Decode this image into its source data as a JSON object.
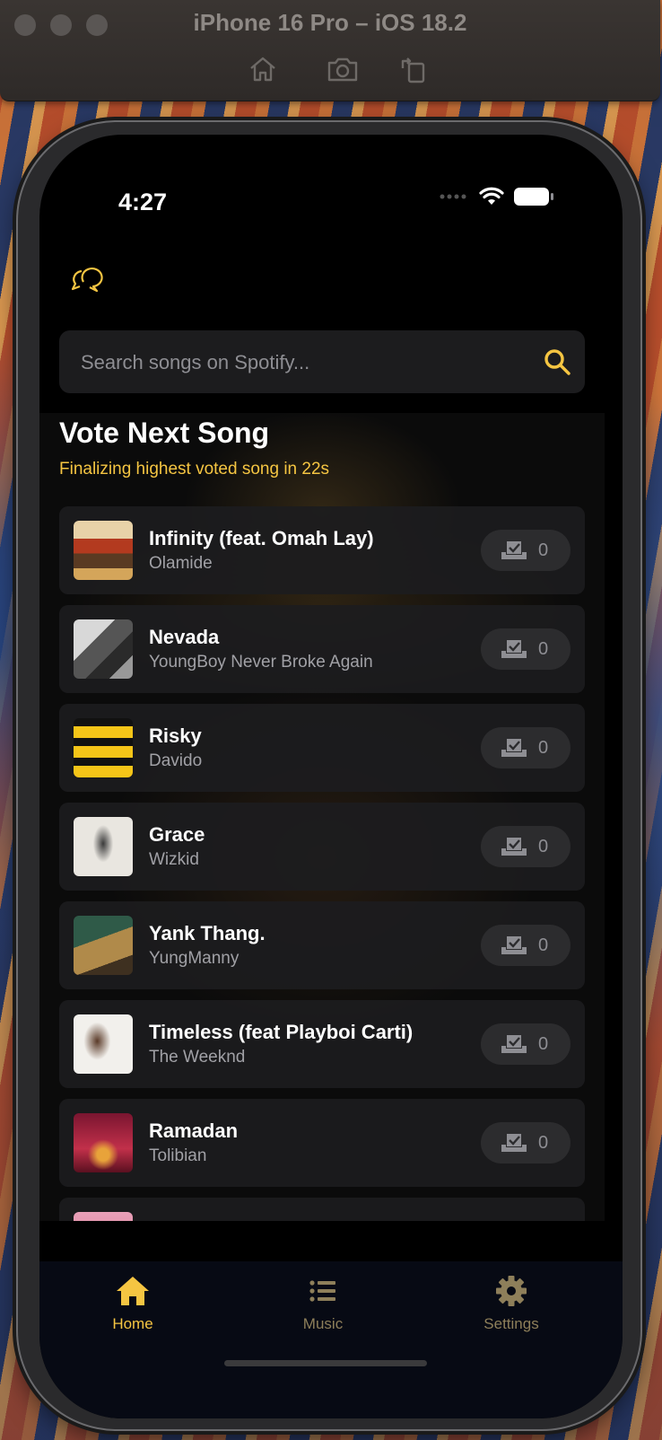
{
  "simulator": {
    "title": "iPhone 16 Pro – iOS 18.2",
    "toolbar": [
      "home-icon",
      "screenshot-icon",
      "rotate-icon"
    ]
  },
  "status_bar": {
    "time": "4:27"
  },
  "search": {
    "placeholder": "Search songs on Spotify..."
  },
  "vote": {
    "title": "Vote Next Song",
    "subtitle": "Finalizing highest voted song in 22s",
    "accent": "#f5c542"
  },
  "songs": [
    {
      "title": "Infinity (feat. Omah Lay)",
      "artist": "Olamide",
      "votes": "0"
    },
    {
      "title": "Nevada",
      "artist": "YoungBoy Never Broke Again",
      "votes": "0"
    },
    {
      "title": "Risky",
      "artist": "Davido",
      "votes": "0"
    },
    {
      "title": "Grace",
      "artist": "Wizkid",
      "votes": "0"
    },
    {
      "title": "Yank Thang.",
      "artist": "YungManny",
      "votes": "0"
    },
    {
      "title": "Timeless (feat Playboi Carti)",
      "artist": "The Weeknd",
      "votes": "0"
    },
    {
      "title": "Ramadan",
      "artist": "Tolibian",
      "votes": "0"
    }
  ],
  "tabs": [
    {
      "label": "Home",
      "icon": "home-icon",
      "active": true
    },
    {
      "label": "Music",
      "icon": "list-icon",
      "active": false
    },
    {
      "label": "Settings",
      "icon": "gear-icon",
      "active": false
    }
  ]
}
